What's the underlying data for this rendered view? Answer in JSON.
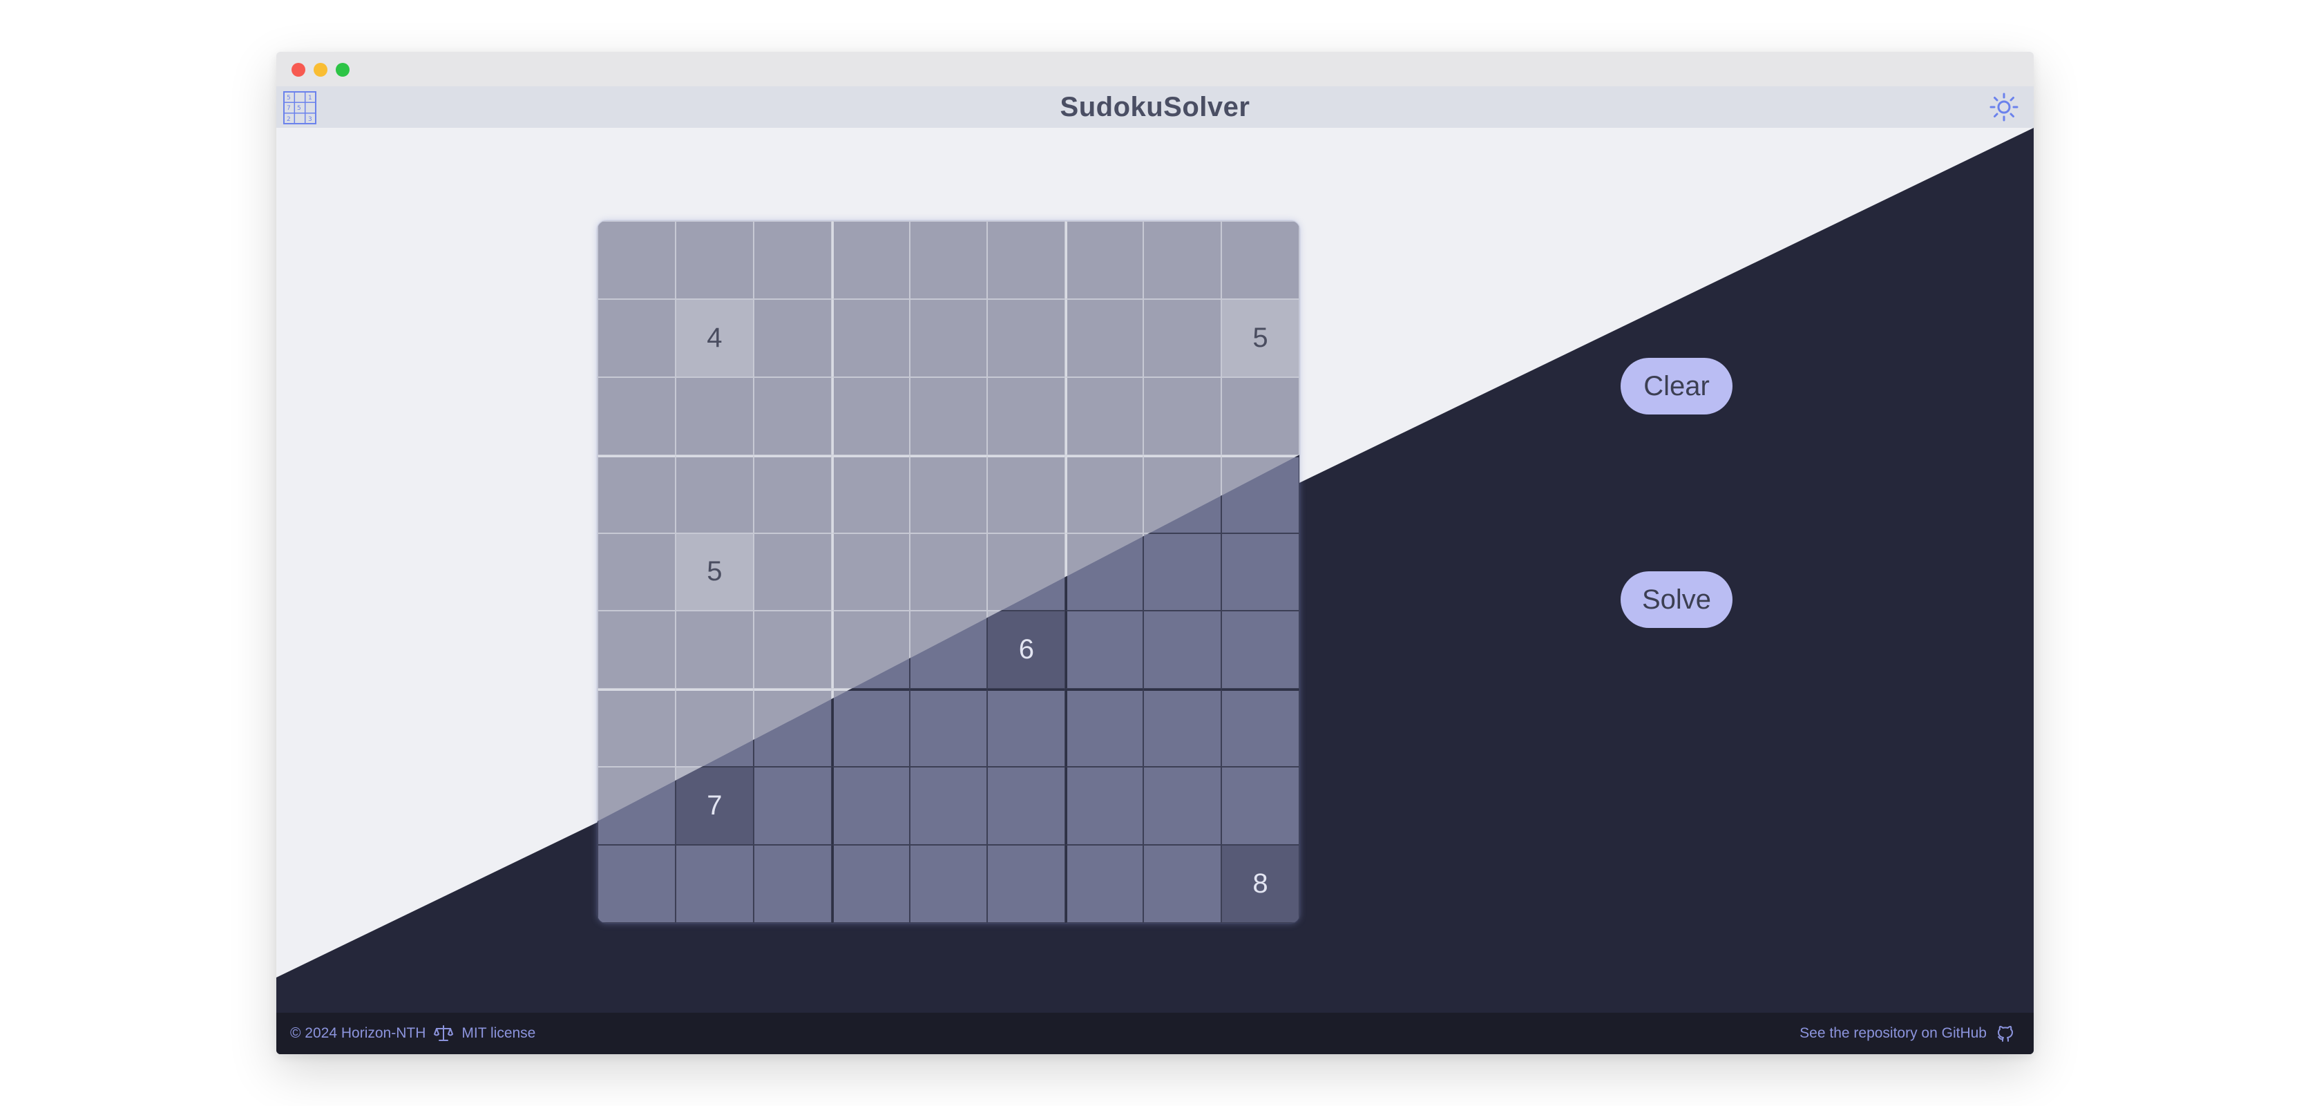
{
  "header": {
    "title": "SudokuSolver",
    "logo_icon": "sudoku-grid-logo",
    "theme_icon": "sun-icon"
  },
  "board": {
    "rows": [
      [
        "",
        "",
        "",
        "",
        "",
        "",
        "",
        "",
        ""
      ],
      [
        "",
        "4",
        "",
        "",
        "",
        "",
        "",
        "",
        "5"
      ],
      [
        "",
        "",
        "",
        "",
        "",
        "",
        "",
        "",
        ""
      ],
      [
        "",
        "",
        "",
        "",
        "",
        "",
        "",
        "",
        ""
      ],
      [
        "",
        "5",
        "",
        "",
        "",
        "",
        "",
        "",
        ""
      ],
      [
        "",
        "",
        "",
        "",
        "",
        "6",
        "",
        "",
        ""
      ],
      [
        "",
        "",
        "",
        "",
        "",
        "",
        "",
        "",
        ""
      ],
      [
        "",
        "7",
        "",
        "",
        "",
        "",
        "",
        "",
        ""
      ],
      [
        "",
        "",
        "",
        "",
        "",
        "",
        "",
        "",
        "8"
      ]
    ]
  },
  "actions": {
    "clear_label": "Clear",
    "solve_label": "Solve"
  },
  "footer": {
    "copyright": "© 2024 Horizon-NTH",
    "license": "MIT license",
    "repo_link": "See the repository on GitHub",
    "license_icon": "scale-icon",
    "repo_icon": "github-icon"
  },
  "colors": {
    "light_bg": "#eff0f4",
    "dark_bg": "#25273a",
    "header_bg": "#dcdfe7",
    "footer_bg": "#1b1c28",
    "accent": "#babdf3",
    "icon_accent": "#6b82ec"
  }
}
